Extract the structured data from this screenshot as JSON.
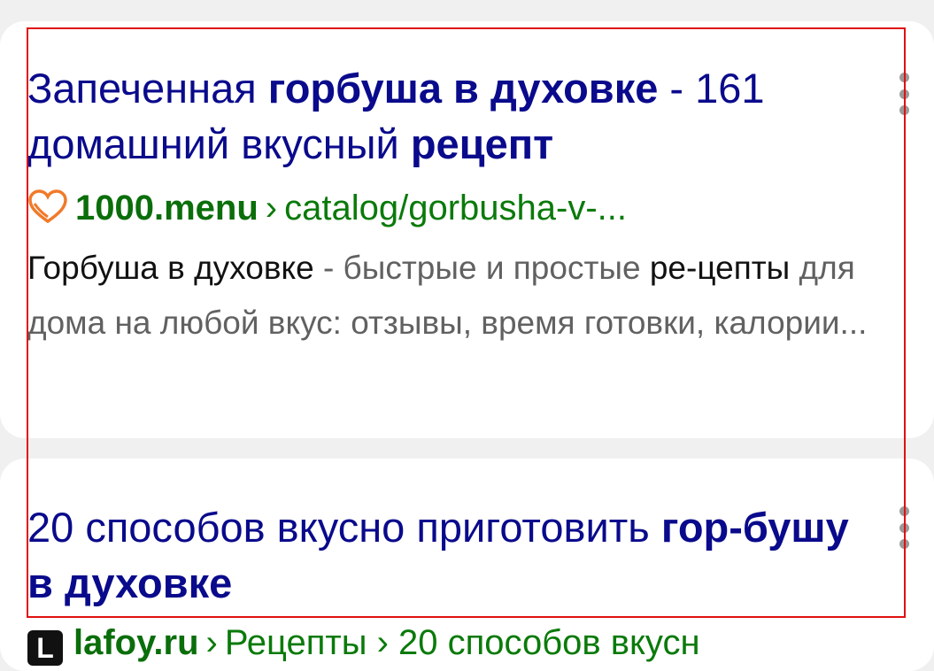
{
  "results": [
    {
      "title_parts": [
        {
          "text": "Запеченная ",
          "bold": false
        },
        {
          "text": "горбуша в духовке",
          "bold": true
        },
        {
          "text": " - 161 домашний вкусный ",
          "bold": false
        },
        {
          "text": "рецепт",
          "bold": true
        }
      ],
      "favicon": "heart-logo-icon",
      "domain": "1000.menu",
      "separator": "›",
      "path": "catalog/gorbusha-v-...",
      "snippet_parts": [
        {
          "text": "Горбуша в духовке",
          "highlight": true
        },
        {
          "text": " - быстрые и простые ",
          "highlight": false
        },
        {
          "text": "ре-цепты",
          "highlight": true
        },
        {
          "text": " для дома на любой вкус: отзывы, время готовки, калории...",
          "highlight": false
        }
      ]
    },
    {
      "title_parts": [
        {
          "text": "20 способов вкусно приготовить ",
          "bold": false
        },
        {
          "text": "гор-бушу в духовке",
          "bold": true
        }
      ],
      "favicon_letter": "L",
      "domain": "lafoy.ru",
      "separator": "›",
      "path": "Рецепты › 20 способов вкусн"
    }
  ],
  "colors": {
    "title": "#0a0a8c",
    "url": "#0a7a0a",
    "snippet": "#616161",
    "snippet_highlight": "#111111",
    "selection_box": "#e01010"
  }
}
